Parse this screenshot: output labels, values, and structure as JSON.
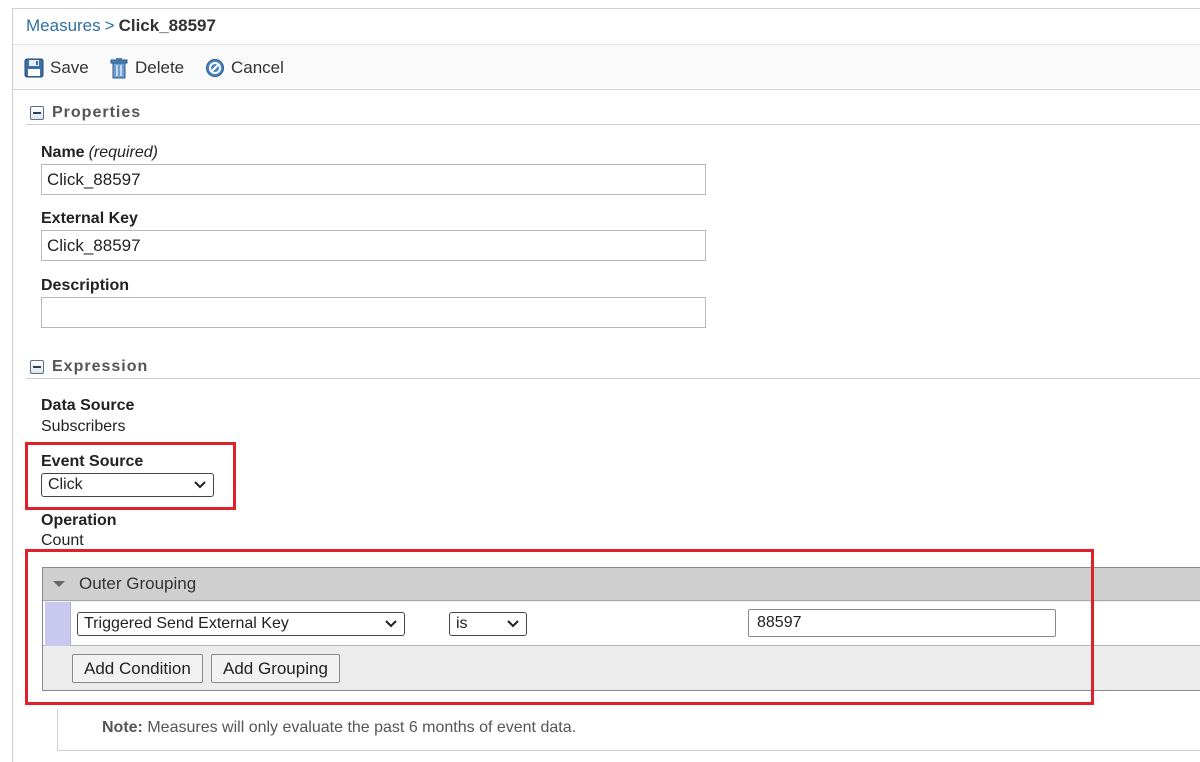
{
  "breadcrumb": {
    "parent": "Measures",
    "separator": ">",
    "current": "Click_88597"
  },
  "toolbar": {
    "save": "Save",
    "delete": "Delete",
    "cancel": "Cancel"
  },
  "properties": {
    "title": "Properties",
    "name_label": "Name",
    "name_required": "(required)",
    "name_value": "Click_88597",
    "external_key_label": "External Key",
    "external_key_value": "Click_88597",
    "description_label": "Description",
    "description_value": ""
  },
  "expression": {
    "title": "Expression",
    "data_source_label": "Data Source",
    "data_source_value": "Subscribers",
    "event_source_label": "Event Source",
    "event_source_value": "Click",
    "operation_label": "Operation",
    "operation_value": "Count"
  },
  "grouping": {
    "title": "Outer Grouping",
    "condition": {
      "field": "Triggered Send External Key",
      "operator": "is",
      "value": "88597"
    },
    "add_condition": "Add Condition",
    "add_grouping": "Add Grouping"
  },
  "note": {
    "label": "Note:",
    "text": "Measures will only evaluate the past 6 months of event data."
  },
  "colors": {
    "highlight": "#e0202a",
    "link": "#2f6f9f",
    "handle": "#c9c9f0"
  }
}
